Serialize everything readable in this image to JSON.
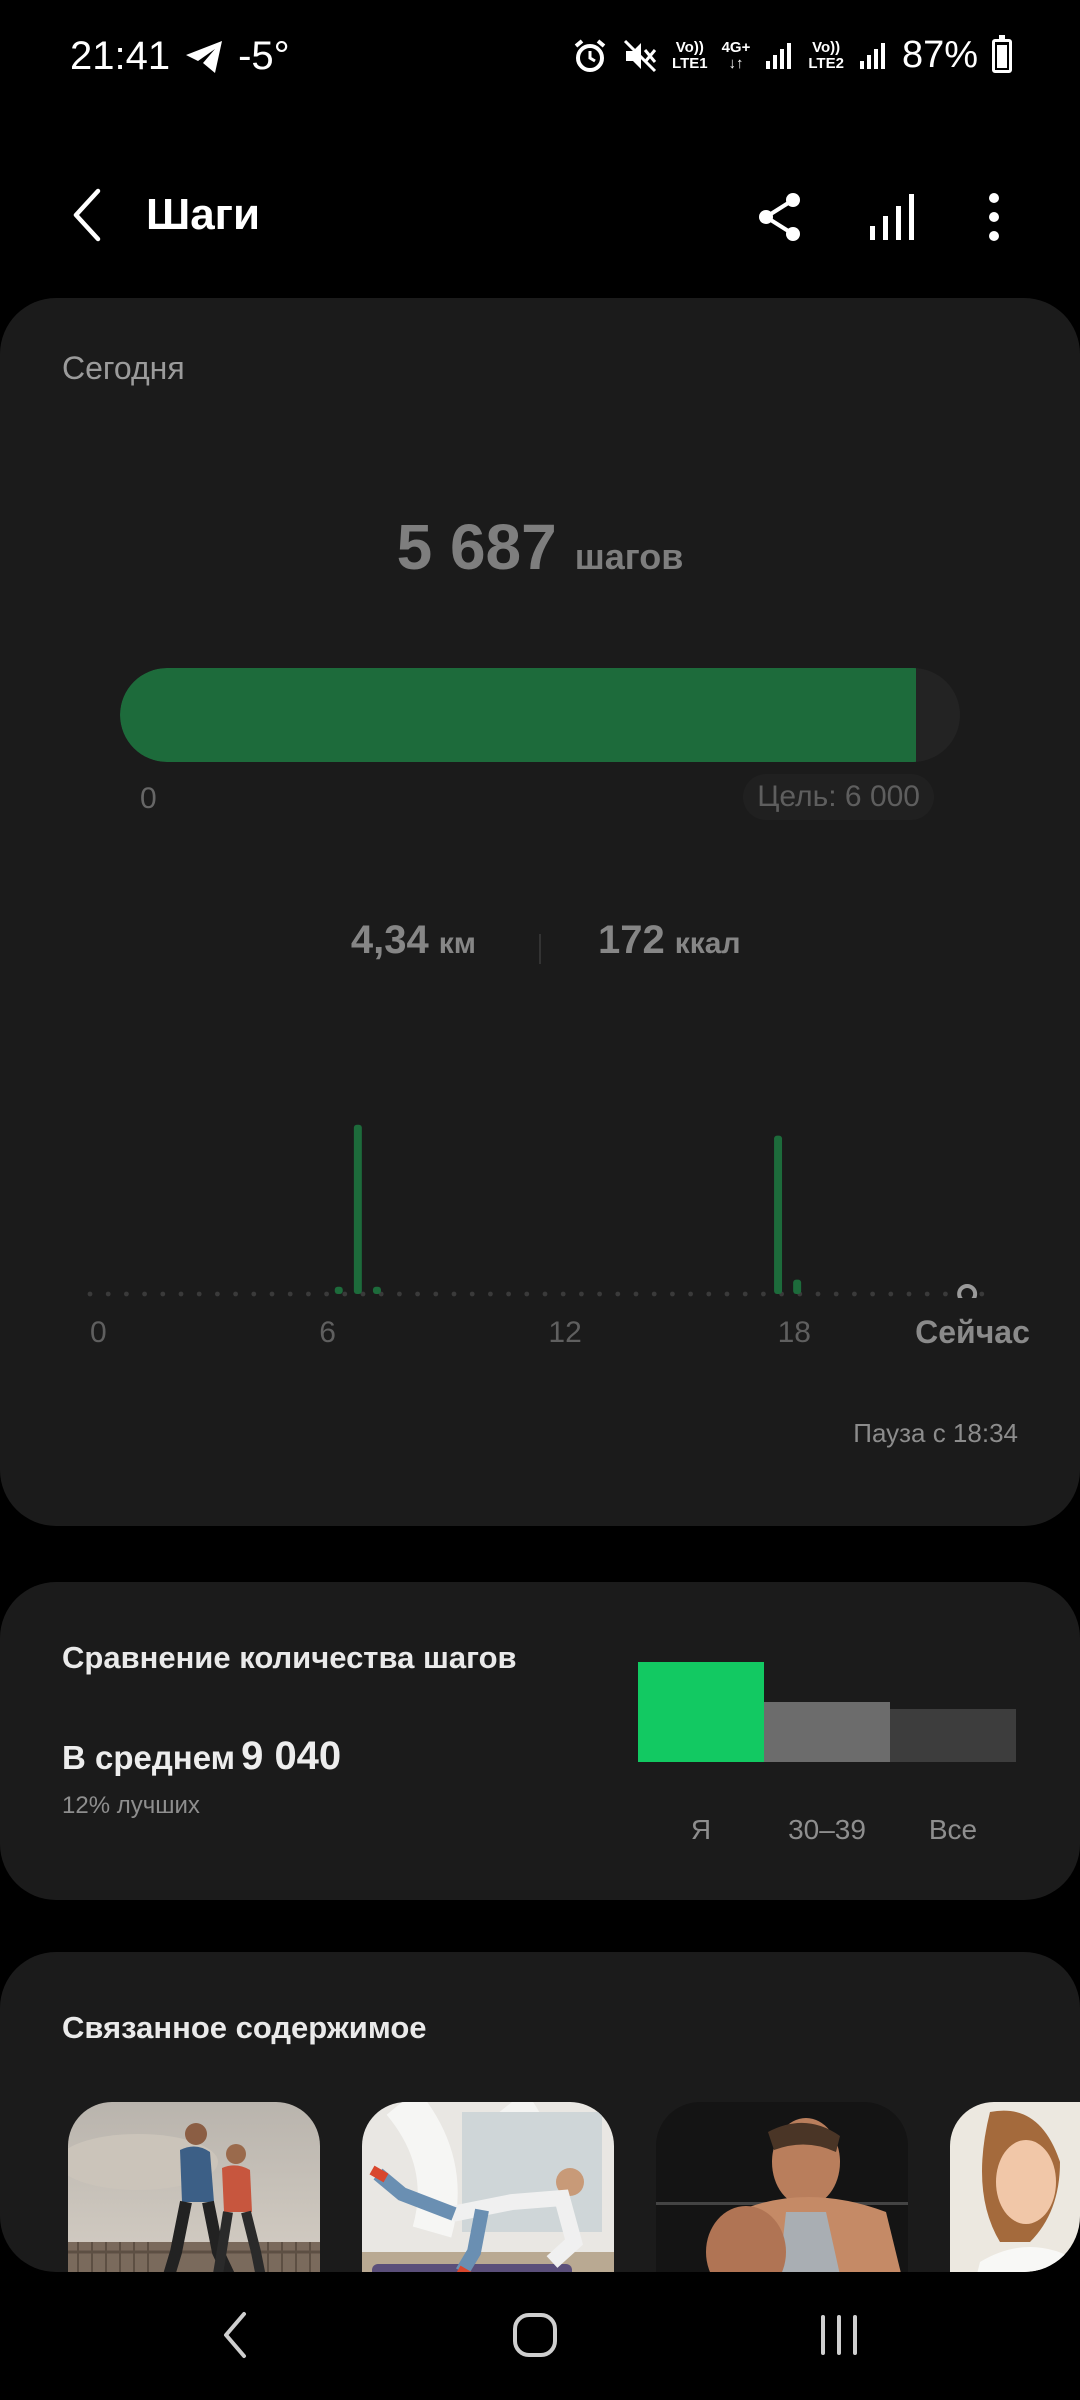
{
  "status_bar": {
    "time": "21:41",
    "temperature": "-5°",
    "sim1_top": "Vo))",
    "sim1_bottom": "LTE1",
    "network_top": "4G+",
    "network_bottom": "↓↑",
    "sim2_top": "Vo))",
    "sim2_bottom": "LTE2",
    "battery": "87%",
    "icons": [
      "telegram-icon",
      "alarm-icon",
      "mute-icon",
      "signal-icon",
      "battery-icon"
    ]
  },
  "header": {
    "title": "Шаги",
    "icons": [
      "back-icon",
      "share-icon",
      "stats-icon",
      "more-icon"
    ]
  },
  "today": {
    "label": "Сегодня",
    "steps": "5 687",
    "steps_unit": "шагов",
    "progress": 0.9478,
    "progress_min": "0",
    "goal": "Цель: 6 000",
    "distance": "4,34",
    "distance_unit": "км",
    "calories": "172",
    "calories_unit": "ккал",
    "pause": "Пауза с 18:34",
    "accent_color": "#1d6b3b"
  },
  "chart_data": {
    "type": "bar",
    "x_ticks": [
      "0",
      "6",
      "12",
      "18"
    ],
    "now_label": "Сейчас",
    "hours_shown": 22.7,
    "bars": [
      {
        "hour": 6.25,
        "level": 0.04
      },
      {
        "hour": 6.75,
        "level": 0.94
      },
      {
        "hour": 7.25,
        "level": 0.04
      },
      {
        "hour": 17.75,
        "level": 0.88
      },
      {
        "hour": 18.25,
        "level": 0.08
      }
    ]
  },
  "compare": {
    "title": "Сравнение количества шагов",
    "average_label": "В среднем",
    "average_value": "9 040",
    "percentile": "12% лучших",
    "bars": [
      {
        "label": "Я",
        "level": 1.0,
        "color": "#12c962"
      },
      {
        "label": "30–39",
        "level": 0.6,
        "color": "#6c6c6c"
      },
      {
        "label": "Все",
        "level": 0.53,
        "color": "#3d3d3d"
      }
    ]
  },
  "related": {
    "title": "Связанное содержимое",
    "items": [
      "running-couple-image",
      "pilates-image",
      "muscle-man-image",
      "woman-image"
    ]
  },
  "nav_bar": {
    "icons": [
      "nav-back-icon",
      "nav-home-icon",
      "nav-recents-icon"
    ]
  }
}
